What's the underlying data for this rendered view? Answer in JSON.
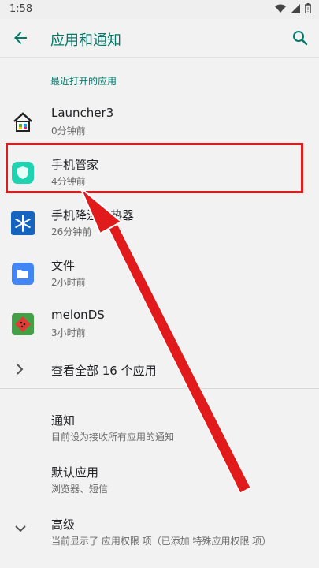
{
  "status": {
    "time": "1:58"
  },
  "appbar": {
    "title": "应用和通知"
  },
  "recent": {
    "label": "最近打开的应用"
  },
  "apps": [
    {
      "name": "Launcher3",
      "time": "0分钟前"
    },
    {
      "name": "手机管家",
      "time": "4分钟前"
    },
    {
      "name": "手机降温散热器",
      "time": "26分钟前"
    },
    {
      "name": "文件",
      "time": "2小时前"
    },
    {
      "name": "melonDS",
      "time": "3小时前"
    }
  ],
  "see_all": {
    "label": "查看全部 16 个应用"
  },
  "settings": [
    {
      "title": "通知",
      "subtitle": "目前设为接收所有应用的通知"
    },
    {
      "title": "默认应用",
      "subtitle": "浏览器、短信"
    },
    {
      "title": "高级",
      "subtitle": "当前显示了 应用权限 项（已添加 特殊应用权限 项）"
    }
  ],
  "colors": {
    "accent": "#00796b",
    "highlight": "#e11b1b"
  }
}
